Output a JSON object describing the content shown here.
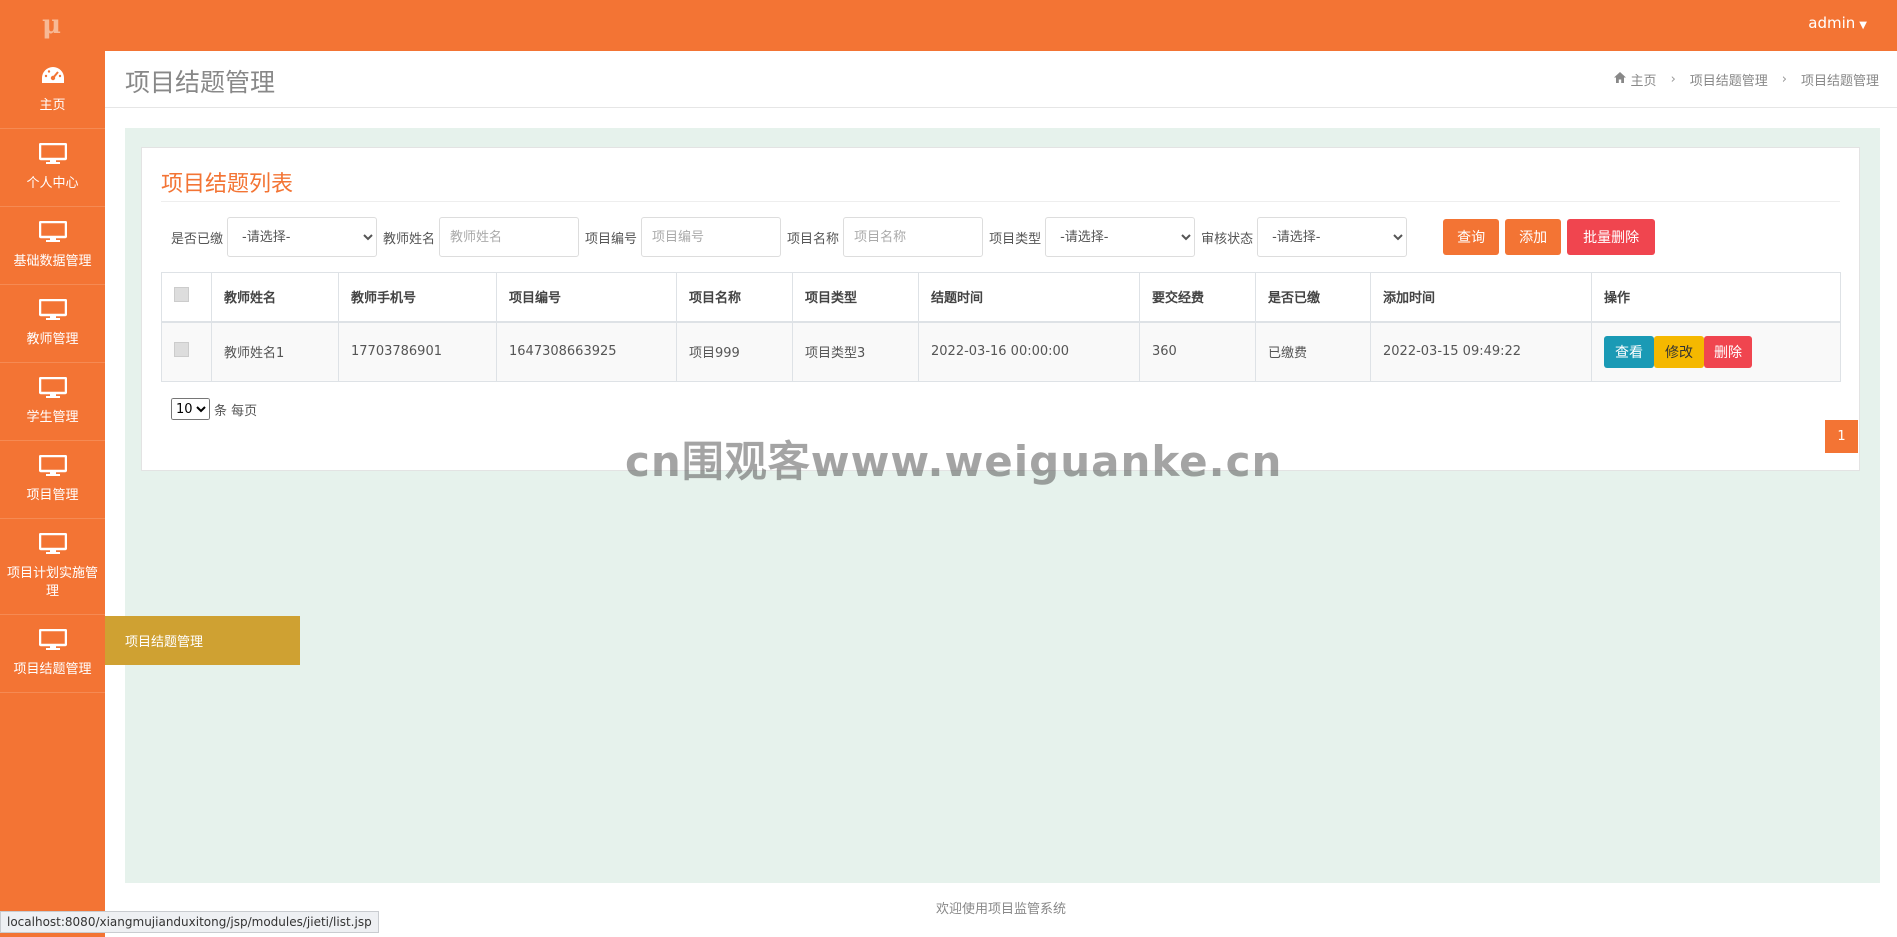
{
  "brand": {
    "logo": "μ"
  },
  "topbar": {
    "user": "admin"
  },
  "sidebar": {
    "items": [
      {
        "label": "主页",
        "icon": "dashboard-icon"
      },
      {
        "label": "个人中心",
        "icon": "monitor-icon"
      },
      {
        "label": "基础数据管理",
        "icon": "monitor-icon"
      },
      {
        "label": "教师管理",
        "icon": "monitor-icon"
      },
      {
        "label": "学生管理",
        "icon": "monitor-icon"
      },
      {
        "label": "项目管理",
        "icon": "monitor-icon"
      },
      {
        "label": "项目计划实施管理",
        "icon": "monitor-icon"
      },
      {
        "label": "项目结题管理",
        "icon": "monitor-icon"
      }
    ],
    "flyout": "项目结题管理"
  },
  "header": {
    "title": "项目结题管理",
    "breadcrumb": [
      "主页",
      "项目结题管理",
      "项目结题管理"
    ]
  },
  "panel": {
    "title": "项目结题列表"
  },
  "filters": {
    "paid_label": "是否已缴",
    "paid_value": "-请选择-",
    "teacher_label": "教师姓名",
    "teacher_placeholder": "教师姓名",
    "code_label": "项目编号",
    "code_placeholder": "项目编号",
    "name_label": "项目名称",
    "name_placeholder": "项目名称",
    "type_label": "项目类型",
    "type_value": "-请选择-",
    "review_label": "审核状态",
    "review_value": "-请选择-",
    "search_button": "查询",
    "add_button": "添加",
    "batch_delete_button": "批量删除"
  },
  "table": {
    "headers": [
      "教师姓名",
      "教师手机号",
      "项目编号",
      "项目名称",
      "项目类型",
      "结题时间",
      "要交经费",
      "是否已缴",
      "添加时间",
      "操作"
    ],
    "rows": [
      {
        "teacher": "教师姓名1",
        "phone": "17703786901",
        "code": "1647308663925",
        "name": "项目999",
        "type": "项目类型3",
        "finish_time": "2022-03-16 00:00:00",
        "fee": "360",
        "paid": "已缴费",
        "added": "2022-03-15 09:49:22",
        "view_button": "查看",
        "edit_button": "修改",
        "delete_button": "删除"
      }
    ]
  },
  "pagination": {
    "page_size": "10",
    "per_page_text": "条 每页",
    "current_page": "1"
  },
  "watermark": "cn围观客www.weiguanke.cn",
  "footer": "欢迎使用项目监管系统",
  "statusbar": "localhost:8080/xiangmujianduxitong/jsp/modules/jieti/list.jsp",
  "colors": {
    "primary": "#f37434",
    "flyout": "#cfa132",
    "danger": "#f0454f",
    "info": "#1a9ab5",
    "warning": "#f5b800",
    "content_bg": "#e6f2ec"
  }
}
